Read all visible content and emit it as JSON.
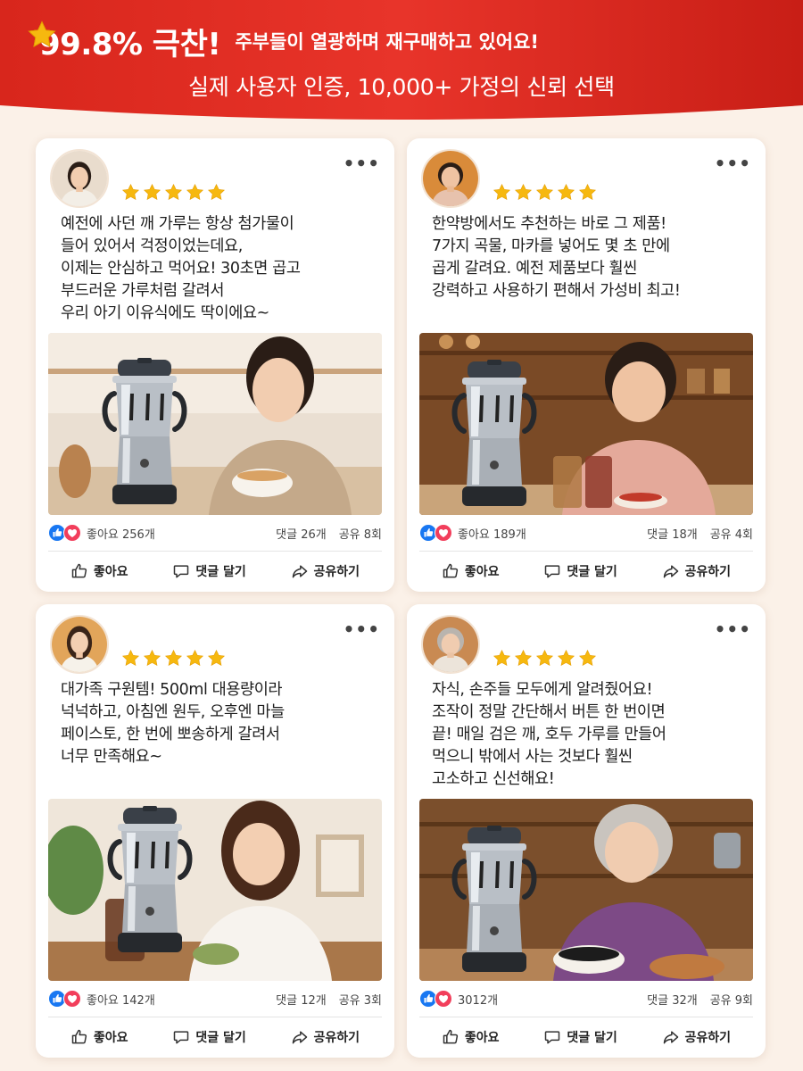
{
  "banner": {
    "star_count": 5,
    "percentage": "99.8% 극찬!",
    "tagline": "주부들이 열광하며 재구매하고 있어요!",
    "subtitle": "실제 사용자 인증, 10,000+ 가정의 신뢰 선택"
  },
  "colors": {
    "banner_red": "#e02a1f",
    "star_gold": "#f6b80f",
    "like_blue": "#1877f2",
    "love_red": "#f23e5b"
  },
  "icons": {
    "more": "more-options-icon",
    "like": "thumbs-up-icon",
    "comment": "comment-icon",
    "share": "share-icon"
  },
  "cards": [
    {
      "rating": 5,
      "review_lines": [
        "예전에 사던 깨 가루는 항상 첨가물이",
        "들어 있어서 걱정이었는데요,",
        "이제는 안심하고 먹어요! 30초면 곱고",
        "부드러운 가루처럼 갈려서",
        "우리 아기 이유식에도 딱이에요~"
      ],
      "likes": "좋아요 256개",
      "comments": "댓글 26개",
      "shares": "공유 8회",
      "actions": {
        "like": "좋아요",
        "comment": "댓글 달기",
        "share": "공유하기"
      }
    },
    {
      "rating": 5,
      "review_lines": [
        "한약방에서도 추천하는 바로 그 제품!",
        "7가지 곡물, 마카를 넣어도 몇 초 만에",
        "곱게 갈려요. 예전 제품보다 훨씬",
        "강력하고 사용하기 편해서 가성비 최고!"
      ],
      "likes": "좋아요 189개",
      "comments": "댓글 18개",
      "shares": "공유 4회",
      "actions": {
        "like": "좋아요",
        "comment": "댓글 달기",
        "share": "공유하기"
      }
    },
    {
      "rating": 5,
      "review_lines": [
        "대가족 구원템! 500ml 대용량이라",
        "넉넉하고, 아침엔 원두, 오후엔 마늘",
        "페이스토, 한 번에 뽀송하게 갈려서",
        "너무 만족해요~"
      ],
      "likes": "좋아요 142개",
      "comments": "댓글 12개",
      "shares": "공유 3회",
      "actions": {
        "like": "좋아요",
        "comment": "댓글 달기",
        "share": "공유하기"
      }
    },
    {
      "rating": 5,
      "review_lines": [
        "자식, 손주들 모두에게 알려줬어요!",
        "조작이 정말 간단해서 버튼 한 번이면",
        "끝! 매일 검은 깨, 호두 가루를 만들어",
        "먹으니 밖에서 사는 것보다 훨씬",
        "고소하고 신선해요!"
      ],
      "likes": "3012개",
      "comments": "댓글 32개",
      "shares": "공유 9회",
      "actions": {
        "like": "좋아요",
        "comment": "댓글 달기",
        "share": "공유하기"
      }
    }
  ]
}
